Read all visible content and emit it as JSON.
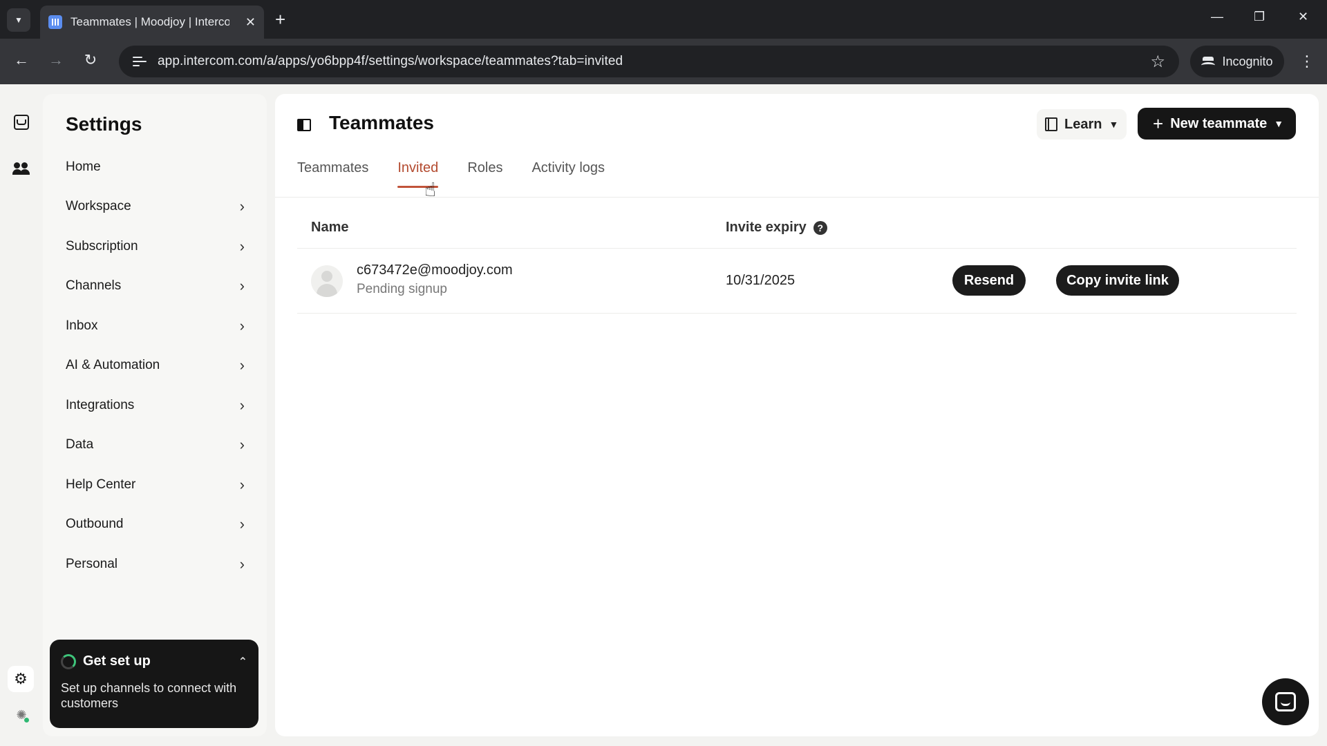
{
  "browser": {
    "tab_title": "Teammates | Moodjoy | Interco",
    "url": "app.intercom.com/a/apps/yo6bpp4f/settings/workspace/teammates?tab=invited",
    "profile_label": "Incognito"
  },
  "settings": {
    "title": "Settings",
    "menu": [
      {
        "label": "Home",
        "has_chevron": false
      },
      {
        "label": "Workspace",
        "has_chevron": true
      },
      {
        "label": "Subscription",
        "has_chevron": true
      },
      {
        "label": "Channels",
        "has_chevron": true
      },
      {
        "label": "Inbox",
        "has_chevron": true
      },
      {
        "label": "AI & Automation",
        "has_chevron": true
      },
      {
        "label": "Integrations",
        "has_chevron": true
      },
      {
        "label": "Data",
        "has_chevron": true
      },
      {
        "label": "Help Center",
        "has_chevron": true
      },
      {
        "label": "Outbound",
        "has_chevron": true
      },
      {
        "label": "Personal",
        "has_chevron": true
      }
    ],
    "setup": {
      "title": "Get set up",
      "body": "Set up channels to connect with customers"
    }
  },
  "page": {
    "title": "Teammates",
    "learn_label": "Learn",
    "new_teammate_label": "New teammate",
    "tabs": [
      "Teammates",
      "Invited",
      "Roles",
      "Activity logs"
    ],
    "active_tab": "Invited"
  },
  "table": {
    "columns": {
      "name": "Name",
      "expiry": "Invite expiry"
    },
    "rows": [
      {
        "email": "c673472e@moodjoy.com",
        "status": "Pending signup",
        "expiry": "10/31/2025",
        "resend_label": "Resend",
        "copy_label": "Copy invite link"
      }
    ]
  },
  "colors": {
    "active_tab": "#b34a2f",
    "primary_button": "#161616"
  }
}
